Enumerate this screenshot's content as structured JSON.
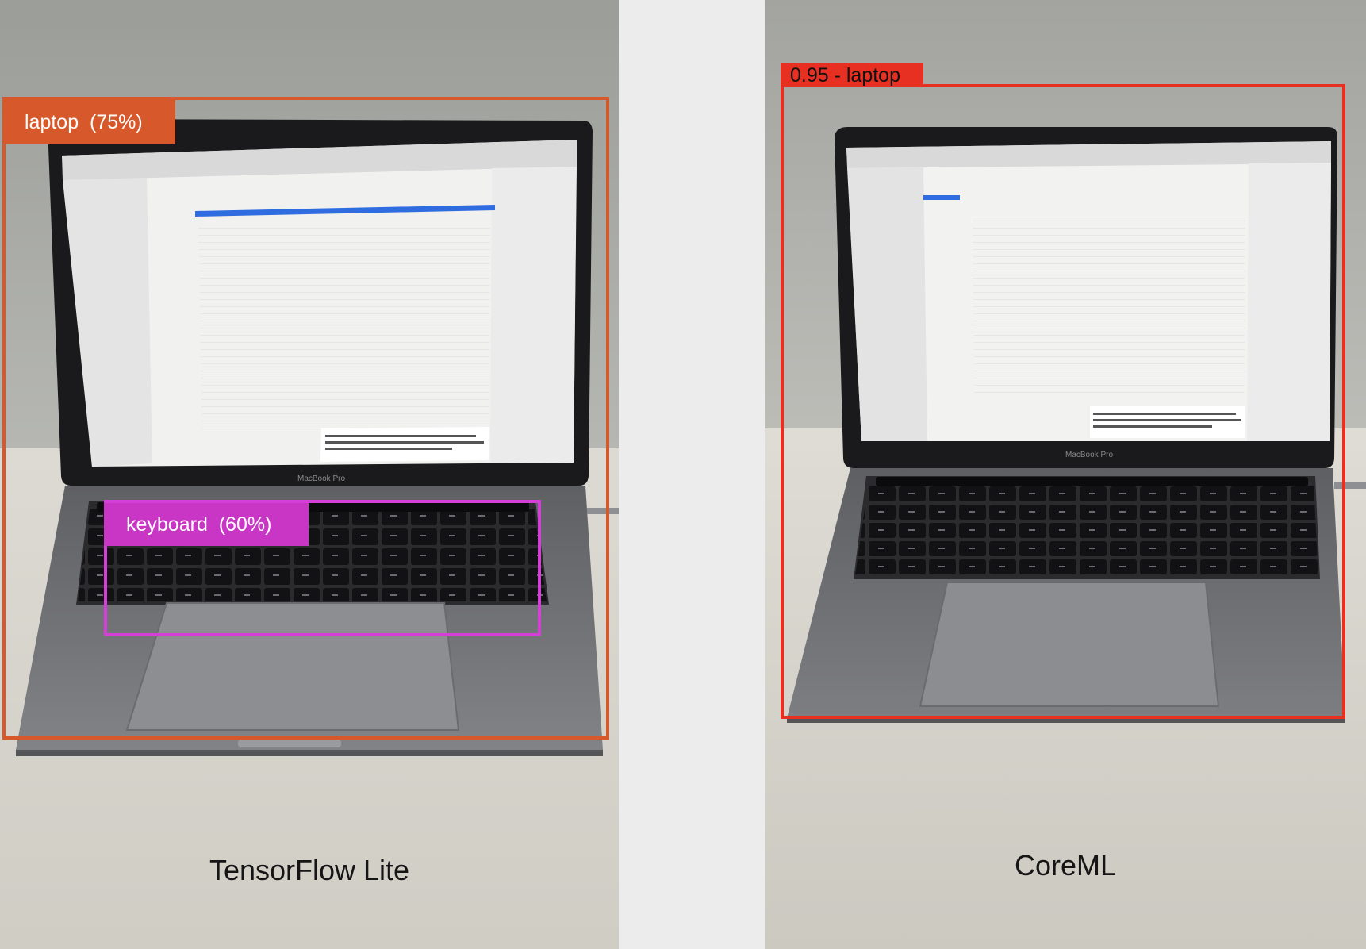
{
  "panels": {
    "left": {
      "caption": "TensorFlow Lite",
      "detections": [
        {
          "label": "laptop  (75%)",
          "color": "#d7582a"
        },
        {
          "label": "keyboard  (60%)",
          "color": "#c936c6"
        }
      ],
      "device_text": "MacBook Pro"
    },
    "right": {
      "caption": "CoreML",
      "detections": [
        {
          "label": "0.95 - laptop",
          "color": "#e73022"
        }
      ],
      "device_text": "MacBook Pro"
    }
  },
  "colors": {
    "background_divider": "#ececec",
    "wall": "#a9aaa6",
    "desk": "#d8d6cd",
    "laptop_body": "#6f7072",
    "bezel": "#1c1c1e",
    "screen": "#f3f3f3",
    "keys": "#0e0e10"
  }
}
